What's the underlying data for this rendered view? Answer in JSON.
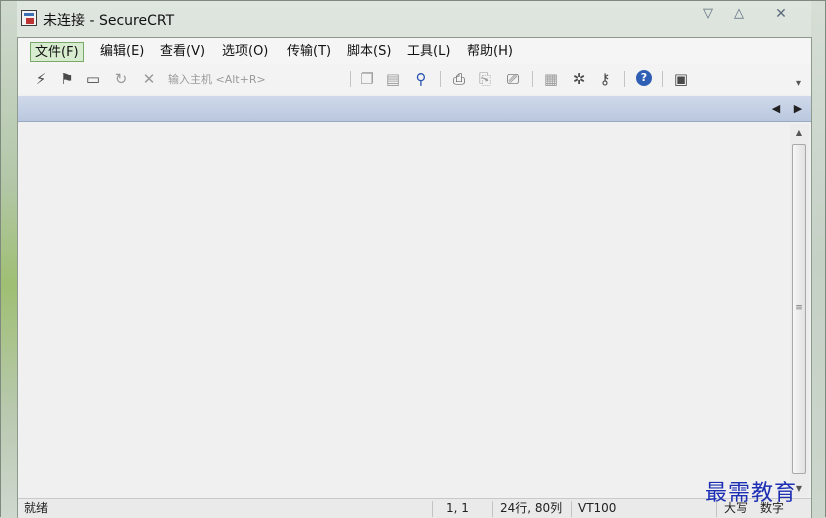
{
  "window": {
    "title": "未连接 - SecureCRT",
    "controls": {
      "minimize": "▽",
      "maximize": "△",
      "close": "✕"
    }
  },
  "menubar": {
    "items": [
      "文件(F)",
      "编辑(E)",
      "查看(V)",
      "选项(O)",
      "传输(T)",
      "脚本(S)",
      "工具(L)",
      "帮助(H)"
    ]
  },
  "toolbar": {
    "host_placeholder": "输入主机 <Alt+R>",
    "icons": [
      "connect-icon",
      "quick-connect-icon",
      "connect-in-tab-icon",
      "reconnect-icon",
      "disconnect-icon",
      "copy-icon",
      "paste-icon",
      "find-icon",
      "print-icon",
      "print-selection-icon",
      "print-setup-icon",
      "session-options-icon",
      "global-options-icon",
      "keymap-icon",
      "help-icon",
      "sftp-icon"
    ]
  },
  "tabs": {
    "left_arrow": "◀",
    "right_arrow": "▶"
  },
  "statusbar": {
    "status": "就绪",
    "cursor": "1,  1",
    "dimensions": "24行, 80列",
    "terminal_type": "VT100",
    "caps": "大写",
    "num": "数字"
  },
  "watermark": "最需教育",
  "colors": {
    "tab_strip": "#c3cfe4",
    "active_menu_border": "#79a86b",
    "watermark": "#1d2fb3"
  }
}
